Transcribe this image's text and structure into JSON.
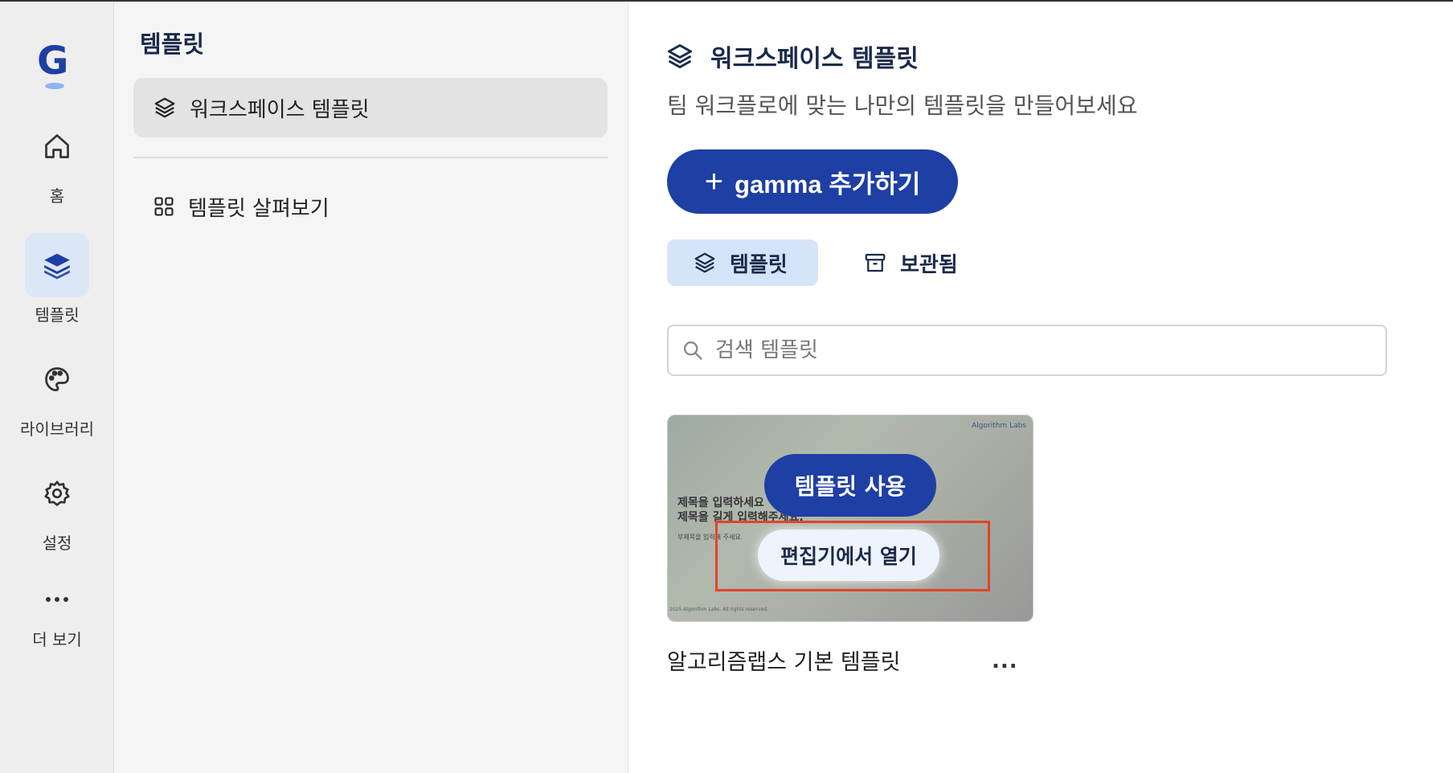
{
  "rail": {
    "logo": "G",
    "items": [
      {
        "label": "홈",
        "icon": "home-icon"
      },
      {
        "label": "템플릿",
        "icon": "layers-icon",
        "active": true
      },
      {
        "label": "라이브러리",
        "icon": "palette-icon"
      },
      {
        "label": "설정",
        "icon": "gear-icon"
      },
      {
        "label": "더 보기",
        "icon": "more-icon"
      }
    ]
  },
  "subnav": {
    "title": "템플릿",
    "items": [
      {
        "label": "워크스페이스 템플릿",
        "icon": "layers-icon",
        "active": true
      },
      {
        "label": "템플릿 살펴보기",
        "icon": "grid-icon"
      }
    ]
  },
  "main": {
    "title": "워크스페이스 템플릿",
    "subtitle": "팀 워크플로에 맞는 나만의 템플릿을 만들어보세요",
    "add_button": "gamma 추가하기",
    "tabs": [
      {
        "label": "템플릿",
        "active": true
      },
      {
        "label": "보관됨"
      }
    ],
    "search_placeholder": "검색 템플릿",
    "card": {
      "name": "알고리즘랩스 기본 템플릿",
      "use_button": "템플릿 사용",
      "open_button": "편집기에서 열기",
      "more": "...",
      "thumbnail": {
        "brand": "Algorithm Labs",
        "title1": "제목을 입력하세요",
        "title2": "제목을 길게 입력해주세요.",
        "subtitle": "부제목을 입력해 주세요.",
        "footer": "2025 Algorithm Labs. All rights reserved."
      }
    }
  },
  "colors": {
    "primary": "#1e3fa3",
    "active_tab_bg": "#d6e4fa",
    "highlight": "#e0442a"
  }
}
